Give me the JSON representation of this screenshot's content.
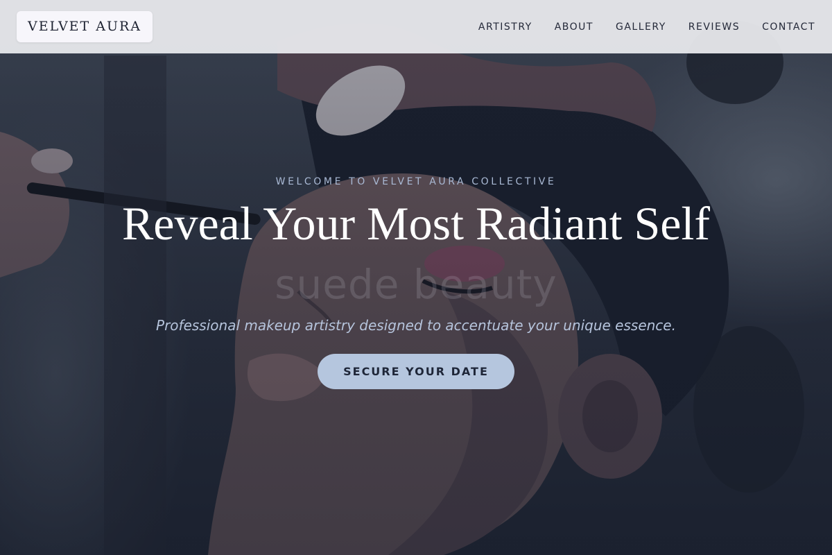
{
  "brand": {
    "logo_text": "VELVET AURA"
  },
  "nav": {
    "items": [
      {
        "label": "ARTISTRY"
      },
      {
        "label": "ABOUT"
      },
      {
        "label": "GALLERY"
      },
      {
        "label": "REVIEWS"
      },
      {
        "label": "CONTACT"
      }
    ]
  },
  "hero": {
    "eyebrow": "WELCOME TO VELVET AURA COLLECTIVE",
    "headline": "Reveal Your Most Radiant Self",
    "watermark": "suede beauty",
    "subhead": "Professional makeup artistry designed to accentuate your unique essence.",
    "cta_label": "SECURE YOUR DATE",
    "image_alt": "makeup-application-photo"
  },
  "colors": {
    "nav_bg": "#ecedf0",
    "accent": "#b5c6de",
    "eyebrow": "#a9b9d4",
    "headline": "#ffffff",
    "text_dark": "#1e2638"
  }
}
